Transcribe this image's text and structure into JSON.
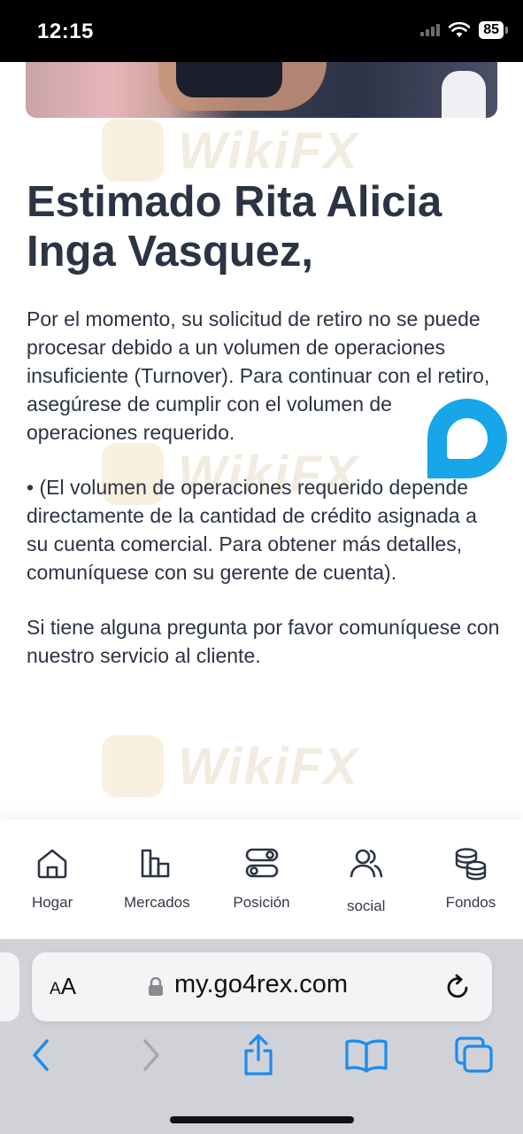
{
  "status_bar": {
    "time": "12:15",
    "battery": "85"
  },
  "greeting": "Estimado Rita Alicia Inga Vasquez,",
  "paragraphs": [
    "Por el momento, su solicitud de retiro no se puede procesar debido a un volumen de operaciones insuficiente (Turnover). Para continuar con el retiro, asegúrese de cumplir con el volumen de operaciones requerido.",
    "• (El volumen de operaciones requerido depende directamente de la cantidad de crédito asignada a su cuenta comercial. Para obtener más detalles, comuníquese con su gerente de cuenta).",
    "Si tiene alguna pregunta por favor comuníquese con nuestro servicio al cliente."
  ],
  "watermark": "WikiFX",
  "bottom_nav": {
    "items": [
      {
        "label": "Hogar",
        "icon": "home-icon"
      },
      {
        "label": "Mercados",
        "icon": "bar-chart-icon"
      },
      {
        "label": "Posición",
        "icon": "toggles-icon"
      },
      {
        "label": "social",
        "icon": "users-icon"
      },
      {
        "label": "Fondos",
        "icon": "coins-icon"
      }
    ]
  },
  "browser": {
    "text_size_label": "AA",
    "url": "my.go4rex.com"
  },
  "colors": {
    "accent": "#17a6e8",
    "text": "#2b3444",
    "browser_blue": "#1a8cf0"
  }
}
